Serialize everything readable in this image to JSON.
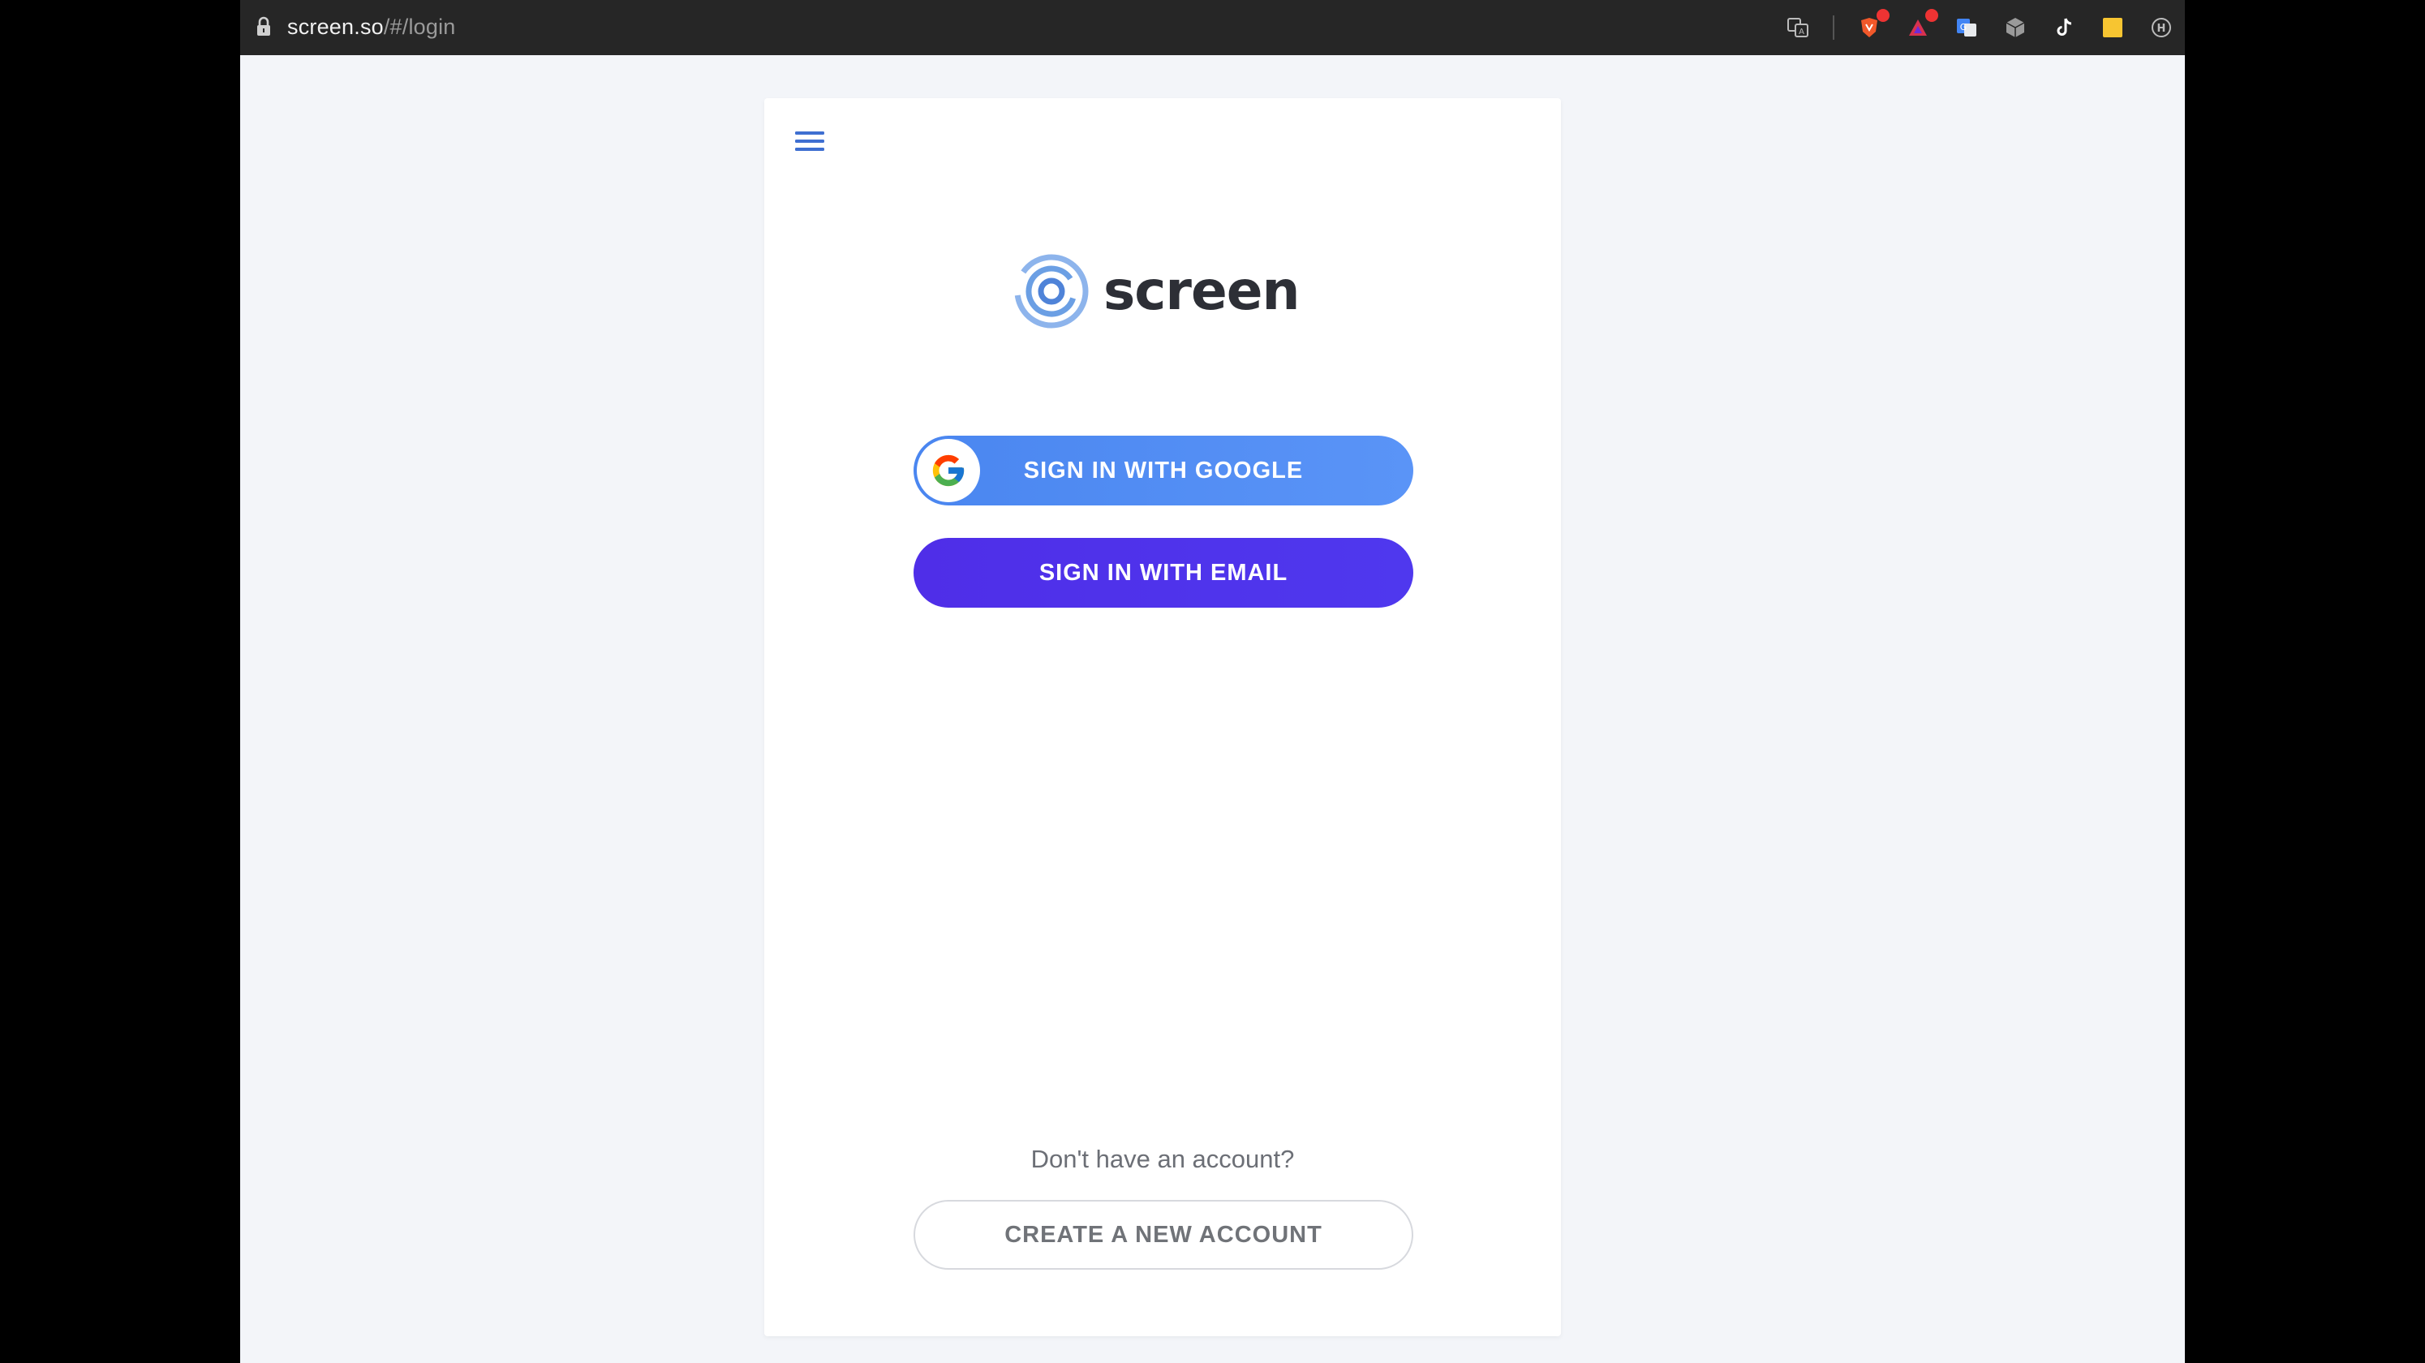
{
  "browser": {
    "url_host": "screen.so",
    "url_path": "/#/login",
    "extensions": [
      {
        "icon": "translate-icon"
      },
      {
        "icon": "brave-shield-icon",
        "badge": ""
      },
      {
        "icon": "brave-rewards-icon",
        "badge": ""
      },
      {
        "icon": "google-translate-icon"
      },
      {
        "icon": "cube-extension-icon"
      },
      {
        "icon": "tiktok-icon"
      },
      {
        "icon": "sticky-note-icon"
      },
      {
        "icon": "profile-extension-icon"
      }
    ]
  },
  "app": {
    "brand_name": "screen",
    "brand_color": "#6b9fe4",
    "google_button_label": "SIGN IN WITH GOOGLE",
    "email_button_label": "SIGN IN WITH EMAIL",
    "no_account_text": "Don't have an account?",
    "create_account_label": "CREATE A NEW ACCOUNT",
    "colors": {
      "google_button": "#4a86f0",
      "email_button": "#4f2ee8",
      "page_background": "#f3f5f9",
      "menu_icon": "#3e6fd1"
    }
  }
}
